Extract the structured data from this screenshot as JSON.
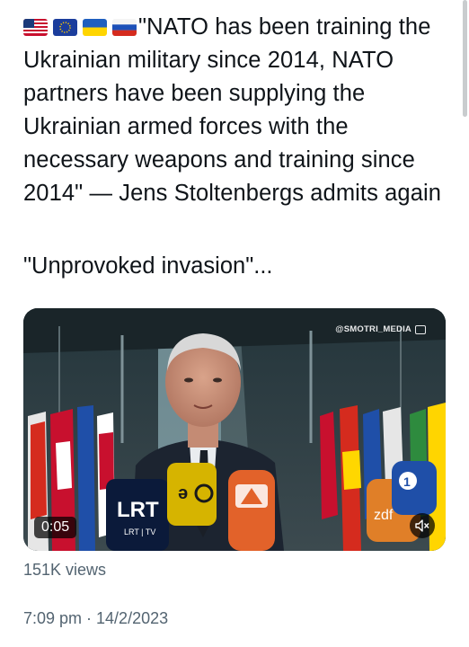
{
  "tweet": {
    "flags": [
      "us-flag-icon",
      "eu-flag-icon",
      "ukraine-flag-icon",
      "russia-flag-icon"
    ],
    "text": "\"NATO has been training the Ukrainian military since 2014, NATO partners have been supplying the Ukrainian armed forces with the necessary weapons and training since 2014\" — Jens Stoltenbergs admits again",
    "text2": "\"Unprovoked invasion\"...",
    "views": "151K views",
    "timestamp": "7:09 pm · 14/2/2023"
  },
  "video": {
    "watermark": "@SMOTRI_MEDIA",
    "duration": "0:05",
    "mic_labels": [
      "LRT",
      "LRT | TV"
    ],
    "mute_icon": "speaker-muted-icon"
  },
  "colors": {
    "text": "#0f1419",
    "secondary": "#536471",
    "background": "#ffffff"
  }
}
